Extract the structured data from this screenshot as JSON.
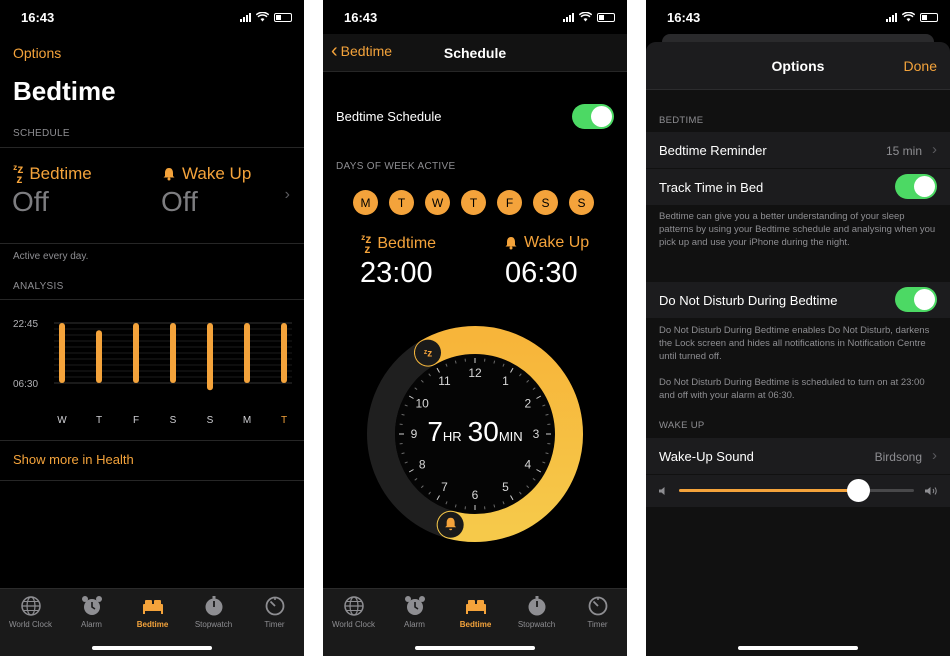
{
  "status": {
    "time": "16:43"
  },
  "tabs": [
    {
      "label": "World Clock"
    },
    {
      "label": "Alarm"
    },
    {
      "label": "Bedtime"
    },
    {
      "label": "Stopwatch"
    },
    {
      "label": "Timer"
    }
  ],
  "screen1": {
    "options": "Options",
    "title": "Bedtime",
    "schedule_header": "SCHEDULE",
    "bedtime_label": "Bedtime",
    "bedtime_value": "Off",
    "wakeup_label": "Wake Up",
    "wakeup_value": "Off",
    "active_text": "Active every day.",
    "analysis_header": "ANALYSIS",
    "show_more": "Show more in Health"
  },
  "chart_data": {
    "type": "bar",
    "categories": [
      "W",
      "T",
      "F",
      "S",
      "S",
      "M",
      "T"
    ],
    "y_labels": [
      "22:45",
      "06:30"
    ],
    "bars": [
      [
        0.0,
        1.0
      ],
      [
        0.12,
        1.0
      ],
      [
        0.0,
        1.0
      ],
      [
        0.0,
        1.0
      ],
      [
        0.0,
        1.12
      ],
      [
        0.0,
        1.0
      ],
      [
        0.0,
        1.0
      ]
    ],
    "highlight_index": 6,
    "color": "#f4a33b"
  },
  "screen2": {
    "back": "Bedtime",
    "title": "Schedule",
    "schedule_label": "Bedtime Schedule",
    "schedule_on": true,
    "days_header": "DAYS OF WEEK ACTIVE",
    "days": [
      "M",
      "T",
      "W",
      "T",
      "F",
      "S",
      "S"
    ],
    "bedtime_label": "Bedtime",
    "bedtime_time": "23:00",
    "wakeup_label": "Wake Up",
    "wakeup_time": "06:30",
    "dial_numbers": [
      "12",
      "1",
      "2",
      "3",
      "4",
      "5",
      "6",
      "7",
      "8",
      "9",
      "10",
      "11"
    ],
    "duration_hr": "7",
    "duration_hr_unit": "HR",
    "duration_min": "30",
    "duration_min_unit": "MIN"
  },
  "screen3": {
    "title": "Options",
    "done": "Done",
    "bedtime_header": "BEDTIME",
    "reminder_label": "Bedtime Reminder",
    "reminder_value": "15 min",
    "track_label": "Track Time in Bed",
    "track_on": true,
    "track_desc": "Bedtime can give you a better understanding of your sleep patterns by using your Bedtime schedule and analysing when you pick up and use your iPhone during the night.",
    "dnd_label": "Do Not Disturb During Bedtime",
    "dnd_on": true,
    "dnd_desc1": "Do Not Disturb During Bedtime enables Do Not Disturb, darkens the Lock screen and hides all notifications in Notification Centre until turned off.",
    "dnd_desc2": "Do Not Disturb During Bedtime is scheduled to turn on at 23:00 and off with your alarm at 06:30.",
    "wakeup_header": "WAKE UP",
    "sound_label": "Wake-Up Sound",
    "sound_value": "Birdsong",
    "volume": 0.76
  },
  "colors": {
    "accent": "#f4a33b",
    "switch_on": "#4cd964",
    "background": "#000000",
    "cell": "#1c1c1e"
  }
}
